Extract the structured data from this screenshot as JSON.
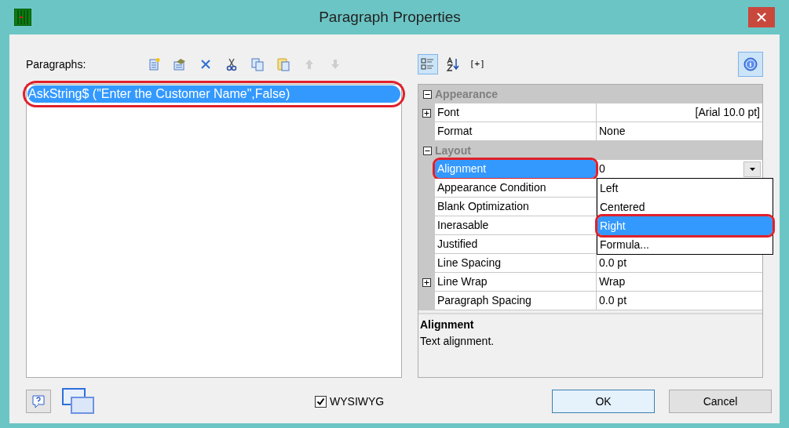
{
  "window": {
    "title": "Paragraph Properties"
  },
  "paragraphs": {
    "label": "Paragraphs:",
    "toolbar": [
      {
        "kind": "new",
        "disabled": false
      },
      {
        "kind": "properties",
        "disabled": false
      },
      {
        "kind": "delete",
        "disabled": false
      },
      {
        "kind": "cut",
        "disabled": false
      },
      {
        "kind": "copy",
        "disabled": false
      },
      {
        "kind": "paste",
        "disabled": false
      },
      {
        "kind": "up",
        "disabled": true
      },
      {
        "kind": "down",
        "disabled": true
      }
    ],
    "items": [
      {
        "text": "AskString$ (\"Enter the Customer Name\",False)",
        "selected": true,
        "annotated": true
      }
    ]
  },
  "property_toolbar": {
    "categorized": {
      "selected": true
    },
    "alphabetical": {
      "selected": false
    },
    "expand_label": "[+]",
    "info": {
      "selected": true
    }
  },
  "property_grid": {
    "categories": [
      {
        "name": "Appearance",
        "expanded": true,
        "properties": [
          {
            "name": "Font",
            "value": "[Arial 10.0 pt]",
            "expandable": true,
            "value_right_aligned": true,
            "selected": false,
            "annotated": false
          },
          {
            "name": "Format",
            "value": "None",
            "expandable": false,
            "value_right_aligned": false,
            "selected": false,
            "annotated": false
          }
        ]
      },
      {
        "name": "Layout",
        "expanded": true,
        "properties": [
          {
            "name": "Alignment",
            "value": "0",
            "expandable": false,
            "value_right_aligned": false,
            "selected": true,
            "annotated": true,
            "kind": "dropdown"
          },
          {
            "name": "Appearance Condition",
            "expandable": false,
            "selected": false,
            "annotated": false
          },
          {
            "name": "Blank Optimization",
            "expandable": false,
            "selected": false,
            "annotated": false
          },
          {
            "name": "Inerasable",
            "expandable": false,
            "selected": false,
            "annotated": false
          },
          {
            "name": "Justified",
            "expandable": false,
            "selected": false,
            "annotated": false
          },
          {
            "name": "Line Spacing",
            "value": "0.0 pt",
            "expandable": false,
            "value_right_aligned": false,
            "selected": false,
            "annotated": false
          },
          {
            "name": "Line Wrap",
            "value": "Wrap",
            "expandable": true,
            "value_right_aligned": false,
            "selected": false,
            "annotated": false
          },
          {
            "name": "Paragraph Spacing",
            "value": "0.0 pt",
            "expandable": false,
            "value_right_aligned": false,
            "selected": false,
            "annotated": false
          }
        ]
      }
    ],
    "dropdown": {
      "options": [
        {
          "label": "Left",
          "selected": false,
          "annotated": false
        },
        {
          "label": "Centered",
          "selected": false,
          "annotated": false
        },
        {
          "label": "Right",
          "selected": true,
          "annotated": true
        },
        {
          "label": "Formula...",
          "selected": false,
          "annotated": false
        }
      ]
    }
  },
  "description": {
    "title": "Alignment",
    "text": "Text alignment."
  },
  "footer": {
    "wysiwyg": {
      "label": "WYSIWYG",
      "checked": true
    },
    "buttons": [
      {
        "label": "OK",
        "default": true
      },
      {
        "label": "Cancel",
        "default": false
      }
    ]
  }
}
